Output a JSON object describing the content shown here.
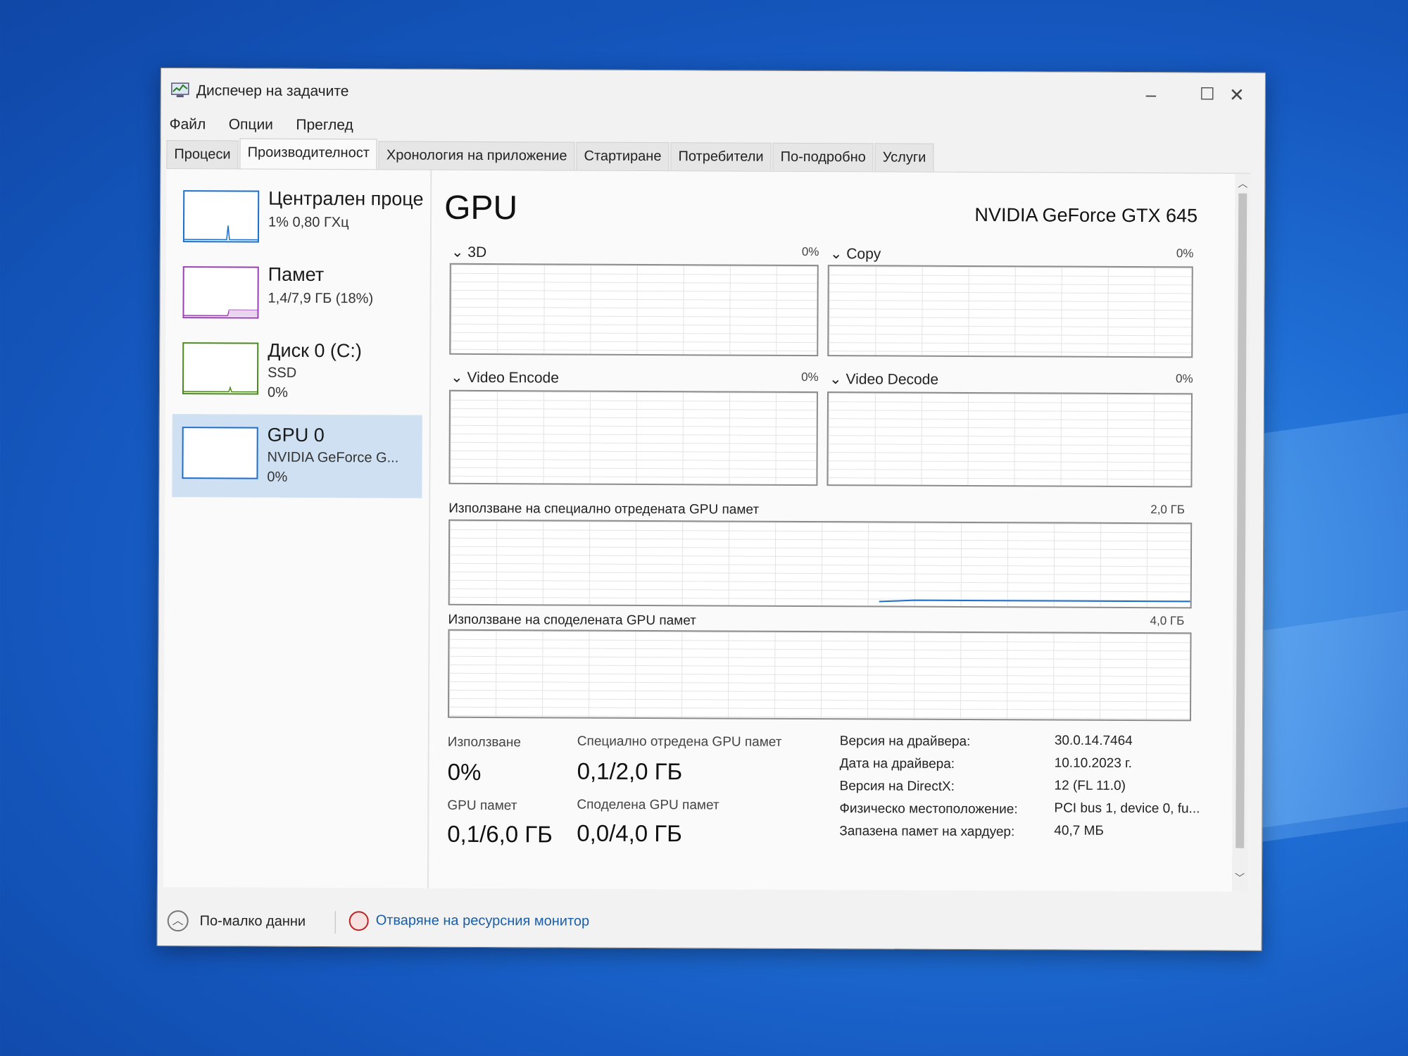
{
  "window": {
    "title": "Диспечер на задачите",
    "minimize": "–",
    "maximize": "☐",
    "close": "✕"
  },
  "menu": [
    "Файл",
    "Опции",
    "Преглед"
  ],
  "tabs": [
    "Процеси",
    "Производителност",
    "Хронология на приложение",
    "Стартиране",
    "Потребители",
    "По-подробно",
    "Услуги"
  ],
  "active_tab": "Производителност",
  "sidebar": [
    {
      "name": "Централен проце",
      "line1": "1% 0,80 ГХц",
      "line2": "",
      "border_color": "#1b6fcf",
      "icon": "cpu-graph"
    },
    {
      "name": "Памет",
      "line1": "1,4/7,9 ГБ (18%)",
      "line2": "",
      "border_color": "#9b3fb5",
      "icon": "memory-graph"
    },
    {
      "name": "Диск 0 (C:)",
      "line1": "SSD",
      "line2": "0%",
      "border_color": "#4d8a1e",
      "icon": "disk-graph"
    },
    {
      "name": "GPU 0",
      "line1": "NVIDIA GeForce G...",
      "line2": "0%",
      "border_color": "#1b6fcf",
      "icon": "gpu-graph"
    }
  ],
  "main": {
    "title": "GPU",
    "model": "NVIDIA GeForce GTX 645",
    "graphs": [
      {
        "label": "3D",
        "percent": "0%"
      },
      {
        "label": "Copy",
        "percent": "0%"
      },
      {
        "label": "Video Encode",
        "percent": "0%"
      },
      {
        "label": "Video Decode",
        "percent": "0%"
      }
    ],
    "dedicated": {
      "label": "Използване на специално отредената GPU памет",
      "max": "2,0 ГБ"
    },
    "shared": {
      "label": "Използване на споделената GPU памет",
      "max": "4,0 ГБ"
    },
    "stats": {
      "usage_label": "Използване",
      "usage_value": "0%",
      "dedicated_label": "Специално отредена GPU памет",
      "dedicated_value": "0,1/2,0 ГБ",
      "gpu_mem_label": "GPU памет",
      "gpu_mem_value": "0,1/6,0 ГБ",
      "shared_label": "Споделена GPU памет",
      "shared_value": "0,0/4,0 ГБ"
    },
    "info": [
      {
        "key": "Версия на драйвера:",
        "value": "30.0.14.7464"
      },
      {
        "key": "Дата на драйвера:",
        "value": "10.10.2023 г."
      },
      {
        "key": "Версия на DirectX:",
        "value": "12 (FL 11.0)"
      },
      {
        "key": "Физическо местоположение:",
        "value": "PCI bus 1, device 0, fu..."
      },
      {
        "key": "Запазена памет на хардуер:",
        "value": "40,7 МБ"
      }
    ]
  },
  "footer": {
    "fewer_details": "По-малко данни",
    "open_resmon": "Отваряне на ресурсния монитор"
  }
}
